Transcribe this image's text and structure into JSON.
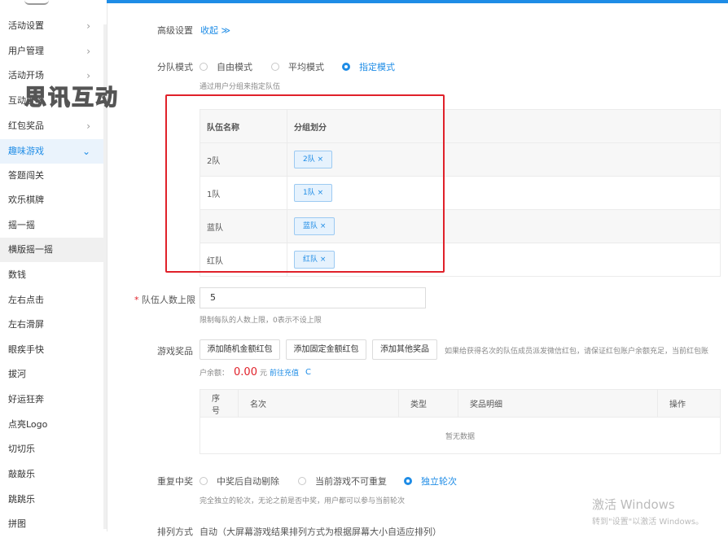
{
  "sidebar": {
    "items": [
      {
        "label": "活动设置",
        "chevron": "›"
      },
      {
        "label": "用户管理",
        "chevron": "›"
      },
      {
        "label": "活动开场",
        "chevron": "›"
      },
      {
        "label": "互动上墙",
        "chevron": ""
      },
      {
        "label": "红包奖品",
        "chevron": "›"
      },
      {
        "label": "趣味游戏",
        "chevron": "⌄"
      },
      {
        "label": "答题闯关",
        "chevron": ""
      },
      {
        "label": "欢乐棋牌",
        "chevron": ""
      },
      {
        "label": "摇一摇",
        "chevron": ""
      },
      {
        "label": "横版摇一摇",
        "chevron": ""
      },
      {
        "label": "数钱",
        "chevron": ""
      },
      {
        "label": "左右点击",
        "chevron": ""
      },
      {
        "label": "左右滑屏",
        "chevron": ""
      },
      {
        "label": "眼疾手快",
        "chevron": ""
      },
      {
        "label": "拔河",
        "chevron": ""
      },
      {
        "label": "好运狂奔",
        "chevron": ""
      },
      {
        "label": "点亮Logo",
        "chevron": ""
      },
      {
        "label": "切切乐",
        "chevron": ""
      },
      {
        "label": "敲敲乐",
        "chevron": ""
      },
      {
        "label": "跳跳乐",
        "chevron": ""
      },
      {
        "label": "拼图",
        "chevron": ""
      }
    ]
  },
  "watermark": "思讯互动",
  "advanced": {
    "label": "高级设置",
    "toggle": "收起 ≫"
  },
  "team_mode": {
    "label": "分队模式",
    "options": [
      "自由模式",
      "平均模式",
      "指定模式"
    ],
    "hint": "通过用户分组来指定队伍"
  },
  "team_table": {
    "headers": [
      "队伍名称",
      "分组划分"
    ],
    "rows": [
      {
        "name": "2队",
        "tag": "2队 ×"
      },
      {
        "name": "1队",
        "tag": "1队 ×"
      },
      {
        "name": "蓝队",
        "tag": "蓝队 ×"
      },
      {
        "name": "红队",
        "tag": "红队 ×"
      }
    ]
  },
  "team_limit": {
    "required": "*",
    "label": "队伍人数上限",
    "value": "5",
    "hint": "限制每队的人数上限，0表示不设上限"
  },
  "prizes": {
    "label": "游戏奖品",
    "buttons": [
      "添加随机金额红包",
      "添加固定金额红包",
      "添加其他奖品"
    ],
    "note": "如果给获得名次的队伍成员派发微信红包，请保证红包账户余额充足，当前红包账",
    "balance_prefix": "户余额：",
    "balance_value": "0.00",
    "balance_unit": "元",
    "recharge": "前往充值",
    "refresh": "C",
    "table_headers": [
      "序号",
      "名次",
      "类型",
      "奖品明细",
      "操作"
    ],
    "empty": "暂无数据"
  },
  "repeat": {
    "label": "重复中奖",
    "options": [
      "中奖后自动剔除",
      "当前游戏不可重复",
      "独立轮次"
    ],
    "hint": "完全独立的轮次，无论之前是否中奖，用户都可以参与当前轮次"
  },
  "sort": {
    "label": "排列方式",
    "value": "自动（大屏幕游戏结果排列方式为根据屏幕大小自适应排列）"
  },
  "windows": {
    "line1": "激活 Windows",
    "line2": "转到\"设置\"以激活 Windows。"
  },
  "colors": {
    "accent": "#1e8ce6",
    "highlight_box": "#e0212a",
    "balance": "#e0212a"
  }
}
